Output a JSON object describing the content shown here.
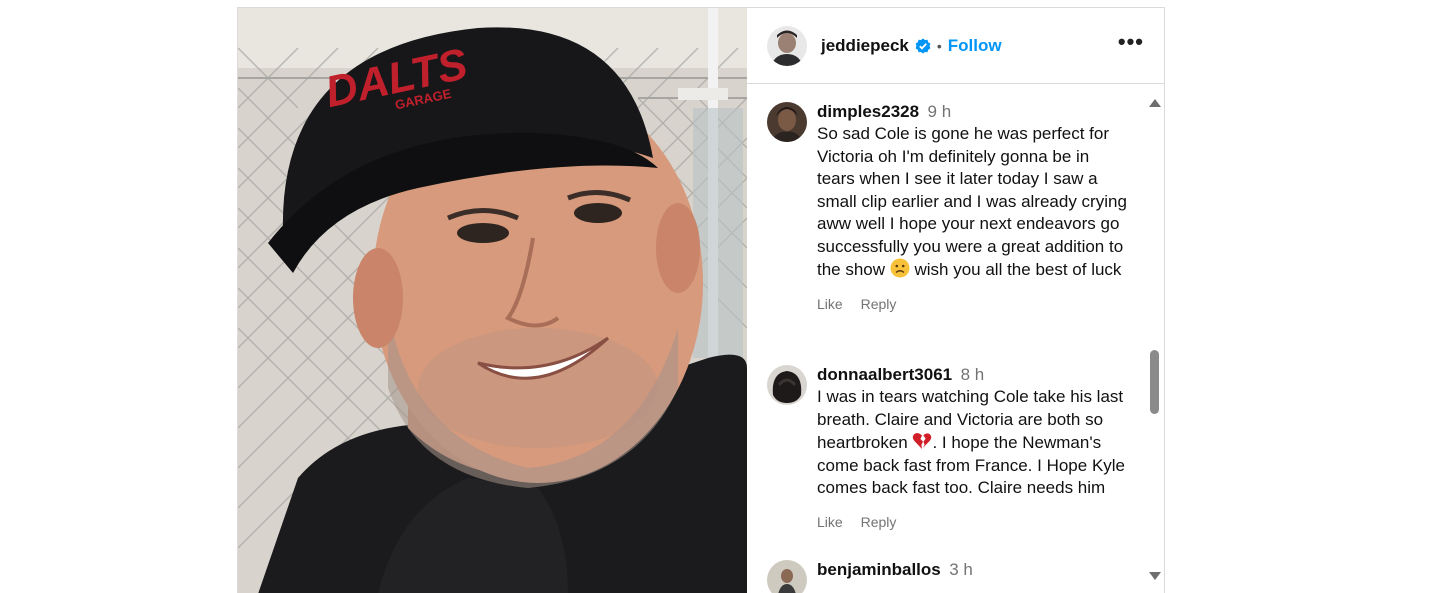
{
  "post": {
    "header": {
      "username": "jeddiepeck",
      "separator": "•",
      "follow_label": "Follow",
      "more_label": "•••",
      "verified_icon": "verified-badge-icon"
    },
    "photo": {
      "cap_text": "DALTS",
      "cap_subtext": "GARAGE"
    },
    "comments": [
      {
        "username": "dimples2328",
        "time": "9 h",
        "text_before_emoji": "So sad Cole is gone he was perfect for Victoria oh I'm definitely gonna be in tears when I see it later today I saw a small clip earlier and I was already crying aww well I hope your next endeavors go successfully you were a great addition to the show ",
        "emoji": "sad-face-emoji",
        "text_after_emoji": " wish you all the best of luck",
        "like_label": "Like",
        "reply_label": "Reply"
      },
      {
        "username": "donnaalbert3061",
        "time": "8 h",
        "text_before_emoji": "I was in tears watching Cole take his last breath. Claire and Victoria are both so heartbroken ",
        "emoji": "broken-heart-emoji",
        "text_after_emoji": ". I hope the Newman's come back fast from France. I Hope Kyle comes back fast too. Claire needs him",
        "like_label": "Like",
        "reply_label": "Reply"
      },
      {
        "username": "benjaminballos",
        "time": "3 h"
      }
    ],
    "colors": {
      "accent": "#0095f6",
      "muted": "#737373",
      "border": "#dbdbdb"
    }
  }
}
